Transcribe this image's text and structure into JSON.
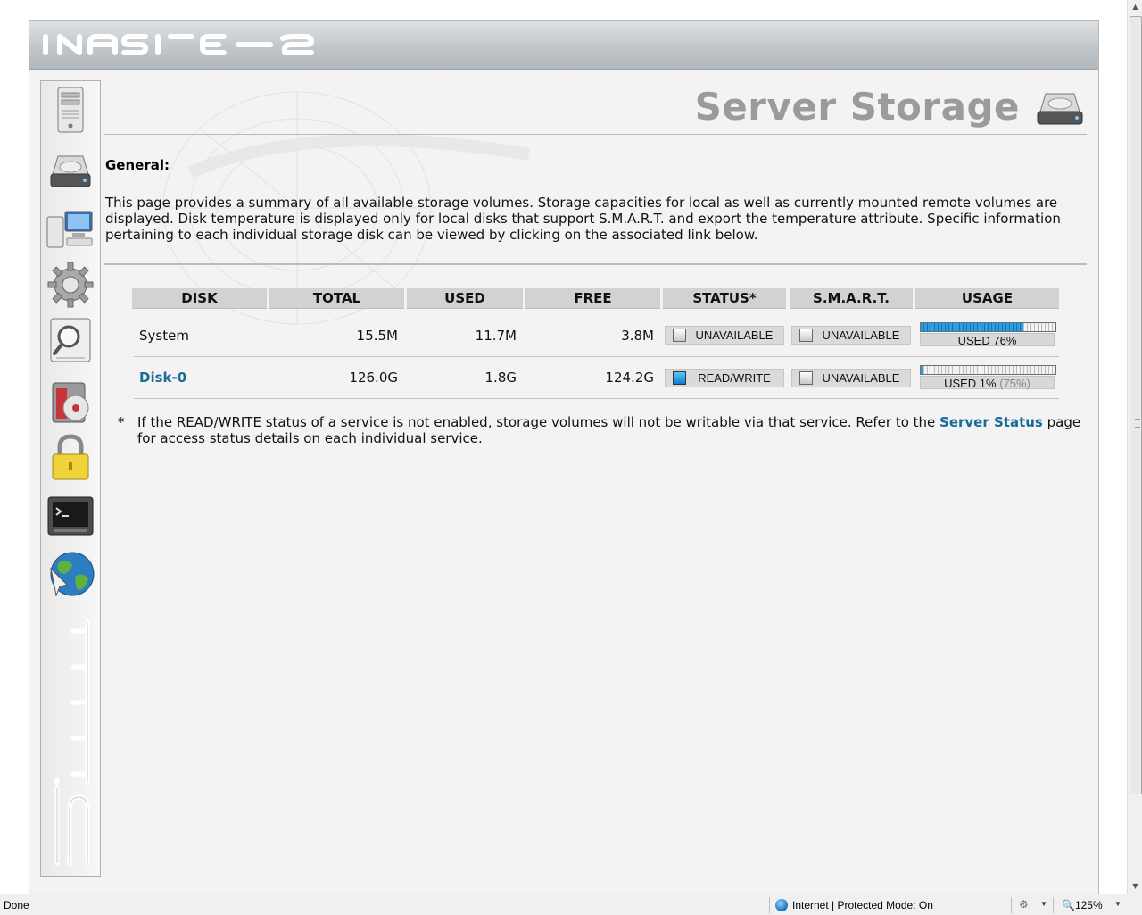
{
  "page": {
    "title": "Server Storage",
    "general_heading": "General:",
    "description": "This page provides a summary of all available storage volumes. Storage capacities for local as well as currently mounted remote volumes are displayed. Disk temperature is displayed only for local disks that support S.M.A.R.T. and export the temperature attribute. Specific information pertaining to each individual storage disk can be viewed by clicking on the associated link below.",
    "footnote_star": "*",
    "footnote_before": "If the READ/WRITE status of a service is not enabled, storage volumes will not be writable via that service. Refer to the ",
    "footnote_link": "Server Status",
    "footnote_after": " page for access status details on each individual service."
  },
  "table": {
    "headers": [
      "DISK",
      "TOTAL",
      "USED",
      "FREE",
      "STATUS*",
      "S.M.A.R.T.",
      "USAGE"
    ],
    "rows": [
      {
        "disk": "System",
        "disk_link": false,
        "total": "15.5M",
        "used": "11.7M",
        "free": "3.8M",
        "status": "UNAVAILABLE",
        "status_on": false,
        "smart": "UNAVAILABLE",
        "smart_on": false,
        "usage_fraction": 0.76,
        "usage_label": "USED 76%",
        "usage_extra": ""
      },
      {
        "disk": "Disk-0",
        "disk_link": true,
        "total": "126.0G",
        "used": "1.8G",
        "free": "124.2G",
        "status": "READ/WRITE",
        "status_on": true,
        "smart": "UNAVAILABLE",
        "smart_on": false,
        "usage_fraction": 0.01,
        "usage_label": "USED 1%",
        "usage_extra": "(75%)"
      }
    ]
  },
  "sidebar": {
    "items": [
      {
        "name": "server-icon"
      },
      {
        "name": "hard-disk-icon"
      },
      {
        "name": "network-icon"
      },
      {
        "name": "gear-icon"
      },
      {
        "name": "search-icon"
      },
      {
        "name": "backup-icon"
      },
      {
        "name": "lock-icon"
      },
      {
        "name": "terminal-icon"
      },
      {
        "name": "globe-icon"
      }
    ]
  },
  "statusbar": {
    "status": "Done",
    "zone": "Internet | Protected Mode: On",
    "zoom": "125%"
  },
  "colors": {
    "accent": "#1a6b9a",
    "usage_fill": "#1a8ad4",
    "title_gray": "#9b9b9b"
  }
}
